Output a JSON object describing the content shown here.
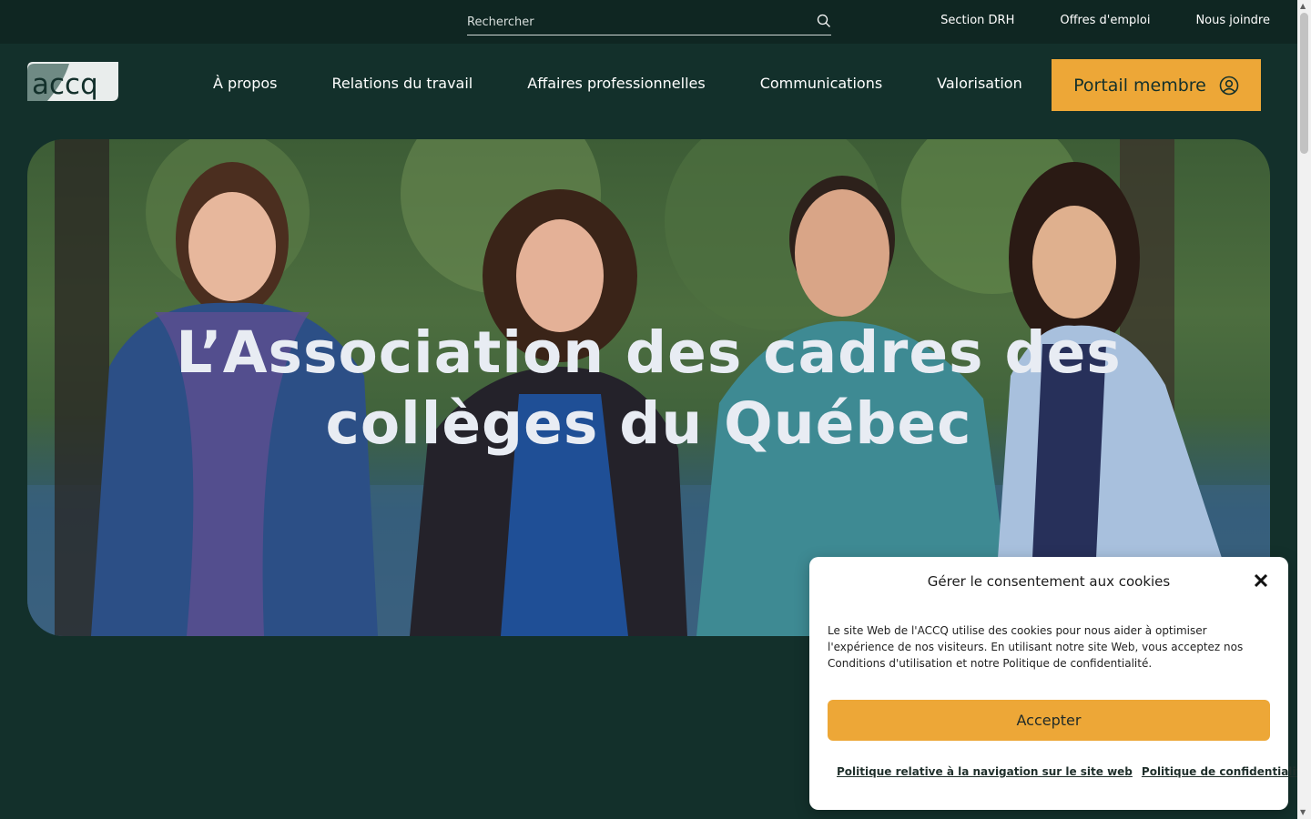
{
  "topbar": {
    "search_placeholder": "Rechercher",
    "links": [
      "Section DRH",
      "Offres d'emploi",
      "Nous joindre"
    ]
  },
  "logo": {
    "text": "accq"
  },
  "nav": {
    "items": [
      "À propos",
      "Relations du travail",
      "Affaires professionnelles",
      "Communications",
      "Valorisation"
    ],
    "portal_label": "Portail membre"
  },
  "hero": {
    "title_line1": "L’Association des cadres des",
    "title_line2": "collèges du Québec"
  },
  "cookie": {
    "title": "Gérer le consentement aux cookies",
    "text": "Le site Web de l'ACCQ utilise des cookies pour nous aider à optimiser l'expérience de nos visiteurs. En utilisant notre site Web, vous acceptez nos Conditions d'utilisation et notre Politique de confidentialité.",
    "accept_label": "Accepter",
    "links": [
      "Politique relative à la navigation sur le site web",
      "Politique de confidentialité"
    ]
  },
  "colors": {
    "background": "#13302b",
    "topbar": "#0f2622",
    "accent": "#eda737"
  }
}
